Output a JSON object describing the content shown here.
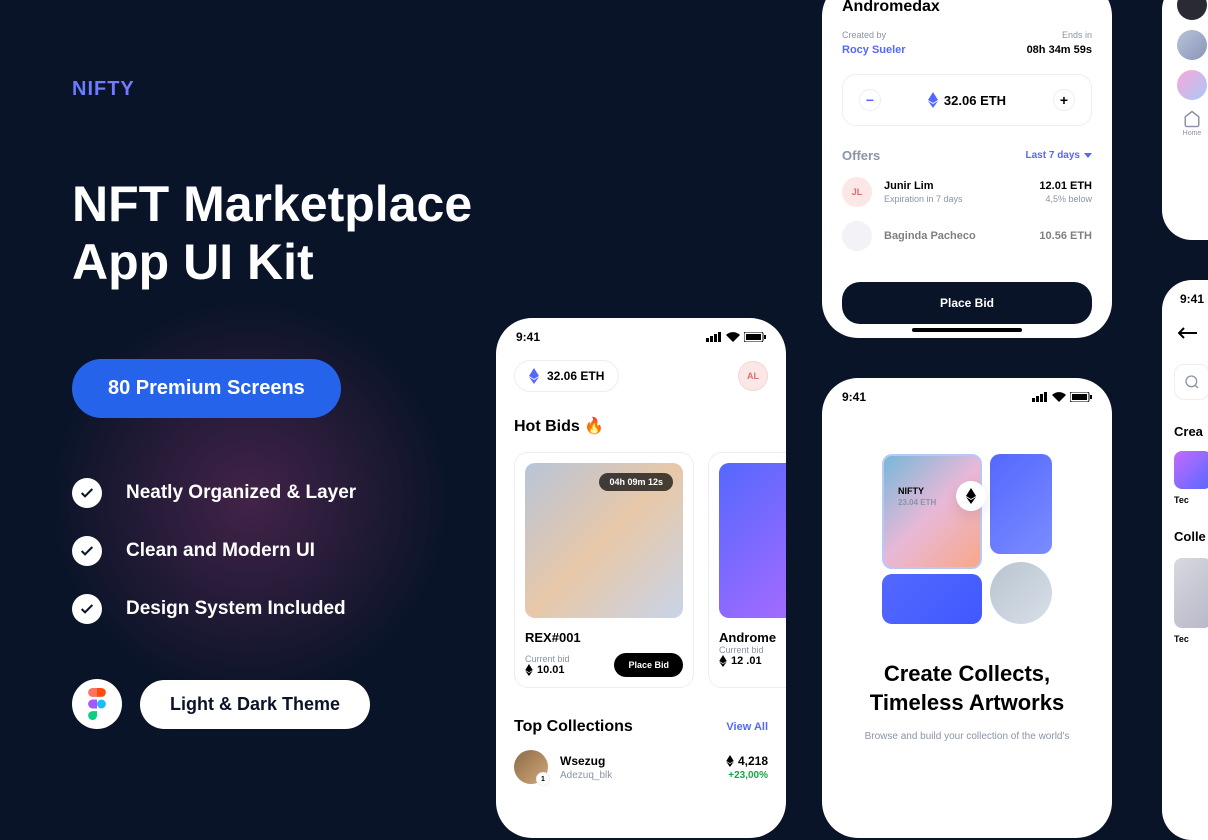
{
  "brand": "NIFTY",
  "headline_line1": "NFT Marketplace",
  "headline_line2": "App UI Kit",
  "cta": "80 Premium Screens",
  "features": [
    "Neatly Organized & Layer",
    "Clean and Modern UI",
    "Design System Included"
  ],
  "theme_label": "Light & Dark Theme",
  "phone1": {
    "time": "9:41",
    "balance": "32.06 ETH",
    "avatar_initials": "AL",
    "hot_bids_title": "Hot Bids 🔥",
    "cards": [
      {
        "timer": "04h 09m 12s",
        "name": "REX#001",
        "bid_label": "Current bid",
        "bid_value": "10.01",
        "btn": "Place Bid"
      },
      {
        "name": "Androme",
        "bid_label": "Current bid",
        "bid_value": "12 .01"
      }
    ],
    "top_collections_title": "Top Collections",
    "view_all": "View All",
    "collections": [
      {
        "rank": "1",
        "name": "Wsezug",
        "creator": "Adezuq_blk",
        "value": "4,218",
        "change": "+23,00%"
      }
    ]
  },
  "phone2": {
    "title": "Andromedax",
    "created_label": "Created by",
    "creator": "Rocy Sueler",
    "ends_label": "Ends in",
    "ends_value": "08h 34m 59s",
    "price": "32.06 ETH",
    "offers_title": "Offers",
    "filter": "Last 7 days",
    "offers": [
      {
        "initials": "JL",
        "name": "Junir Lim",
        "exp": "Expiration in 7 days",
        "price": "12.01 ETH",
        "below": "4,5% below"
      },
      {
        "name": "Baginda Pacheco",
        "price": "10.56 ETH"
      }
    ],
    "place_bid": "Place Bid"
  },
  "phone3": {
    "time": "9:41",
    "hero_name": "NIFTY",
    "hero_price": "23.04 ETH",
    "headline_line1": "Create Collects,",
    "headline_line2": "Timeless Artworks",
    "sub": "Browse and build your collection of the world's"
  },
  "phone4": {
    "home_label": "Home",
    "time": "9:41",
    "section_creators": "Crea",
    "label_tec": "Tec",
    "section_collections": "Colle"
  }
}
